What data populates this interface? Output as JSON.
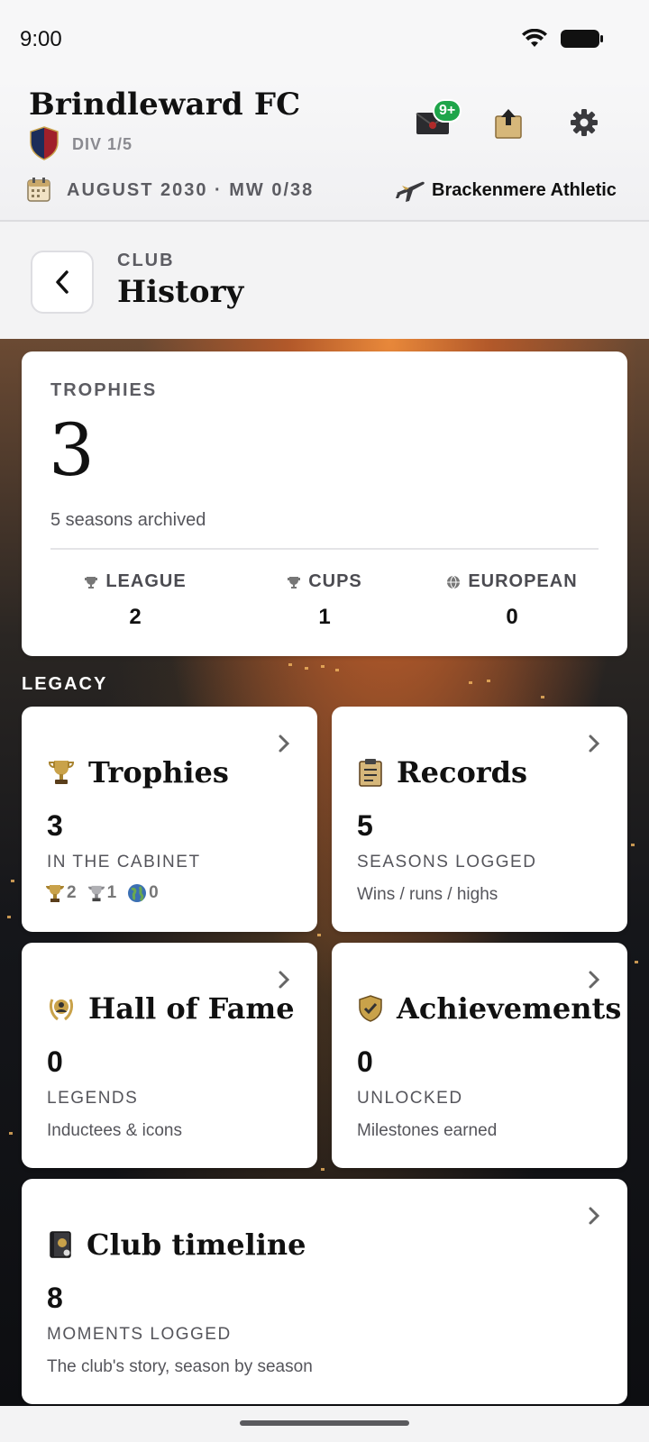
{
  "status": {
    "time": "9:00"
  },
  "header": {
    "club_name": "Brindleward FC",
    "division": "DIV 1/5",
    "mail_badge": "9+",
    "date": "AUGUST 2030 · MW 0/38",
    "opponent": "Brackenmere Athletic",
    "icons": [
      "mail-icon",
      "upload-icon",
      "gear-icon",
      "calendar-icon",
      "plane-icon"
    ]
  },
  "page": {
    "kicker": "CLUB",
    "title": "History"
  },
  "summary": {
    "kicker": "TROPHIES",
    "total": "3",
    "subtitle": "5 seasons archived",
    "stats": [
      {
        "label": "LEAGUE",
        "value": "2"
      },
      {
        "label": "CUPS",
        "value": "1"
      },
      {
        "label": "EUROPEAN",
        "value": "0"
      }
    ]
  },
  "legacy": {
    "label": "LEGACY",
    "tiles": [
      {
        "title": "Trophies",
        "number": "3",
        "caption": "IN THE CABINET",
        "mini": [
          "2",
          "1",
          "0"
        ]
      },
      {
        "title": "Records",
        "number": "5",
        "caption": "SEASONS LOGGED",
        "description": "Wins / runs / highs"
      },
      {
        "title": "Hall of Fame",
        "number": "0",
        "caption": "LEGENDS",
        "description": "Inductees & icons"
      },
      {
        "title": "Achievements",
        "number": "0",
        "caption": "UNLOCKED",
        "description": "Milestones earned"
      },
      {
        "title": "Club timeline",
        "number": "8",
        "caption": "MOMENTS LOGGED",
        "description": "The club's story, season by season"
      }
    ]
  },
  "colors": {
    "badge": "#1fa54a",
    "text": "#111111",
    "muted": "#55555b"
  }
}
